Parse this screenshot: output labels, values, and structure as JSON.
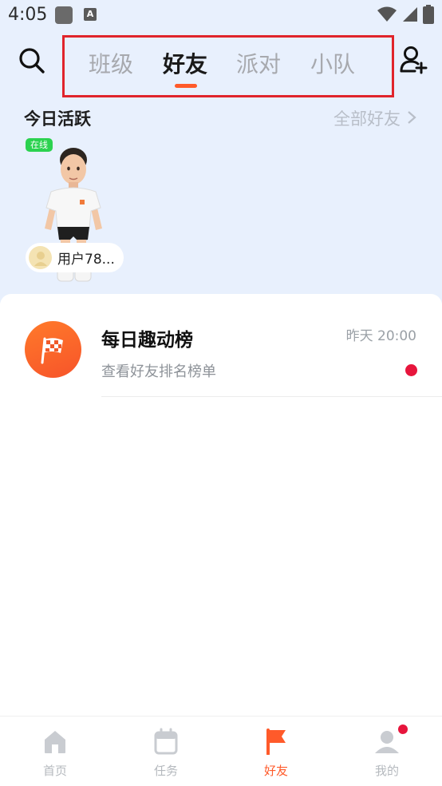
{
  "status_bar": {
    "time": "4:05",
    "notification_icon": "A"
  },
  "header": {
    "search_icon": "search-icon",
    "add_friend_icon": "add-user-icon",
    "tabs": [
      {
        "label": "班级",
        "active": false
      },
      {
        "label": "好友",
        "active": true
      },
      {
        "label": "派对",
        "active": false
      },
      {
        "label": "小队",
        "active": false
      }
    ]
  },
  "active_today": {
    "title": "今日活跃",
    "all_friends_label": "全部好友",
    "users": [
      {
        "status": "在线",
        "name": "用户78..."
      }
    ]
  },
  "list": {
    "items": [
      {
        "title": "每日趣动榜",
        "subtitle": "查看好友排名榜单",
        "time": "昨天 20:00",
        "unread": true,
        "icon": "checkered-flag-icon"
      }
    ]
  },
  "bottom_nav": {
    "items": [
      {
        "label": "首页",
        "icon": "home-icon",
        "active": false
      },
      {
        "label": "任务",
        "icon": "calendar-icon",
        "active": false
      },
      {
        "label": "好友",
        "icon": "flag-icon",
        "active": true
      },
      {
        "label": "我的",
        "icon": "profile-icon",
        "active": false,
        "badge": true
      }
    ]
  },
  "colors": {
    "accent": "#ff5a2a",
    "badge_red": "#e7153c",
    "online_green": "#2bd24f",
    "header_bg": "#e8f0fd"
  }
}
